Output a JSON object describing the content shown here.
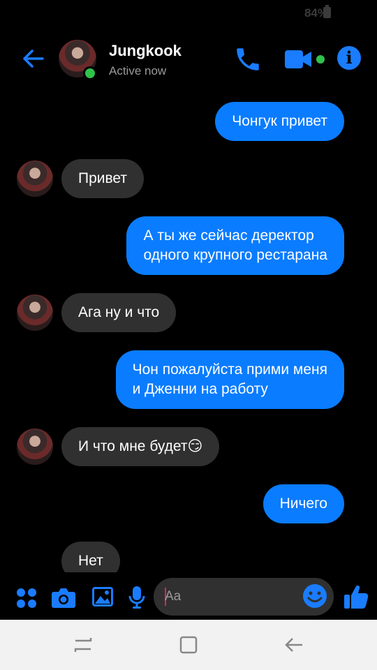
{
  "status": {
    "battery": "84%"
  },
  "header": {
    "name": "Jungkook",
    "status": "Active now"
  },
  "messages": [
    {
      "side": "out",
      "text": "Чонгук привет"
    },
    {
      "side": "in",
      "text": "Привет"
    },
    {
      "side": "out",
      "text": "А ты же сейчас деректор\nодного крупного рестарана"
    },
    {
      "side": "in",
      "text": "Ага ну и что"
    },
    {
      "side": "out",
      "text": "Чон пожалуйста прими меня\nи Дженни на работу"
    },
    {
      "side": "in",
      "text": "И что мне будет😏"
    },
    {
      "side": "out",
      "text": "Ничего"
    },
    {
      "side": "in",
      "text": "Нет"
    }
  ],
  "composer": {
    "placeholder": "Aa"
  },
  "colors": {
    "accent": "#0a7cff",
    "incoming": "#303030",
    "active": "#31c24d"
  }
}
